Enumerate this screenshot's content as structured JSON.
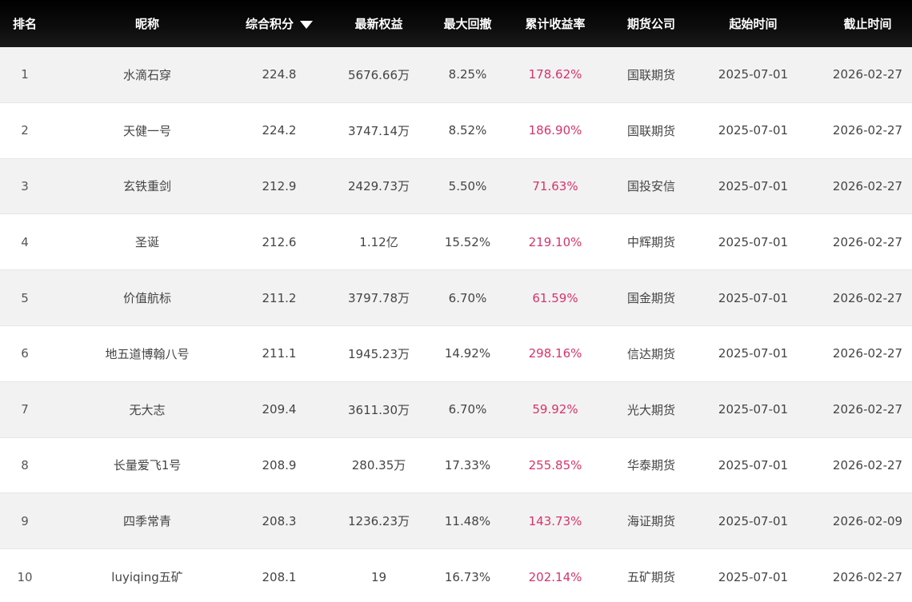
{
  "header": {
    "columns": [
      "排名",
      "昵称",
      "综合积分",
      "最新权益",
      "最大回撤",
      "累计收益率",
      "期货公司",
      "起始时间",
      "截止时间"
    ],
    "sort_icon": "sort-down-icon"
  },
  "colors": {
    "header_bg": "#000000",
    "row_alt_bg": "#f2f2f2",
    "return_color": "#d6336c"
  },
  "rows": [
    {
      "rank": "1",
      "name": "水滴石穿",
      "score": "224.8",
      "equity": "5676.66万",
      "drawdown": "8.25%",
      "return": "178.62%",
      "company": "国联期货",
      "start": "2025-07-01",
      "end": "2026-02-27"
    },
    {
      "rank": "2",
      "name": "天健一号",
      "score": "224.2",
      "equity": "3747.14万",
      "drawdown": "8.52%",
      "return": "186.90%",
      "company": "国联期货",
      "start": "2025-07-01",
      "end": "2026-02-27"
    },
    {
      "rank": "3",
      "name": "玄铁重剑",
      "score": "212.9",
      "equity": "2429.73万",
      "drawdown": "5.50%",
      "return": "71.63%",
      "company": "国投安信",
      "start": "2025-07-01",
      "end": "2026-02-27"
    },
    {
      "rank": "4",
      "name": "圣诞",
      "score": "212.6",
      "equity": "1.12亿",
      "drawdown": "15.52%",
      "return": "219.10%",
      "company": "中辉期货",
      "start": "2025-07-01",
      "end": "2026-02-27"
    },
    {
      "rank": "5",
      "name": "价值航标",
      "score": "211.2",
      "equity": "3797.78万",
      "drawdown": "6.70%",
      "return": "61.59%",
      "company": "国金期货",
      "start": "2025-07-01",
      "end": "2026-02-27"
    },
    {
      "rank": "6",
      "name": "地五道博翰八号",
      "score": "211.1",
      "equity": "1945.23万",
      "drawdown": "14.92%",
      "return": "298.16%",
      "company": "信达期货",
      "start": "2025-07-01",
      "end": "2026-02-27"
    },
    {
      "rank": "7",
      "name": "无大志",
      "score": "209.4",
      "equity": "3611.30万",
      "drawdown": "6.70%",
      "return": "59.92%",
      "company": "光大期货",
      "start": "2025-07-01",
      "end": "2026-02-27"
    },
    {
      "rank": "8",
      "name": "长量爱飞1号",
      "score": "208.9",
      "equity": "280.35万",
      "drawdown": "17.33%",
      "return": "255.85%",
      "company": "华泰期货",
      "start": "2025-07-01",
      "end": "2026-02-27"
    },
    {
      "rank": "9",
      "name": "四季常青",
      "score": "208.3",
      "equity": "1236.23万",
      "drawdown": "11.48%",
      "return": "143.73%",
      "company": "海证期货",
      "start": "2025-07-01",
      "end": "2026-02-09"
    },
    {
      "rank": "10",
      "name": "luyiqing五矿",
      "score": "208.1",
      "equity": "19",
      "drawdown": "16.73%",
      "return": "202.14%",
      "company": "五矿期货",
      "start": "2025-07-01",
      "end": "2026-02-27"
    }
  ]
}
